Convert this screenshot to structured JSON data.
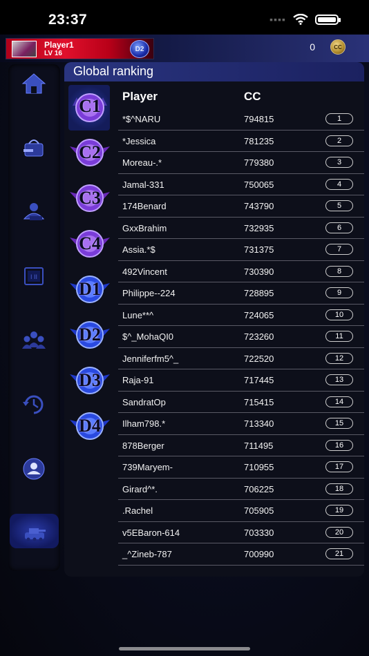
{
  "status": {
    "time": "23:37"
  },
  "player": {
    "name": "Player1",
    "level": "LV 16",
    "badge": "D2"
  },
  "currency": {
    "amount": "0",
    "icon_label": "CC"
  },
  "panel": {
    "title": "Global ranking"
  },
  "table": {
    "headers": {
      "player": "Player",
      "cc": "CC"
    },
    "rows": [
      {
        "name": "*$^NARU",
        "cc": "794815",
        "rank": "1"
      },
      {
        "name": "*Jessica",
        "cc": "781235",
        "rank": "2"
      },
      {
        "name": "Moreau-.*",
        "cc": "779380",
        "rank": "3"
      },
      {
        "name": "Jamal-331",
        "cc": "750065",
        "rank": "4"
      },
      {
        "name": "174Benard",
        "cc": "743790",
        "rank": "5"
      },
      {
        "name": "GxxBrahim",
        "cc": "732935",
        "rank": "6"
      },
      {
        "name": "Assia.*$",
        "cc": "731375",
        "rank": "7"
      },
      {
        "name": "492Vincent",
        "cc": "730390",
        "rank": "8"
      },
      {
        "name": "Philippe--224",
        "cc": "728895",
        "rank": "9"
      },
      {
        "name": "Lune**^",
        "cc": "724065",
        "rank": "10"
      },
      {
        "name": "$^_MohaQI0",
        "cc": "723260",
        "rank": "11"
      },
      {
        "name": "Jenniferfm5^_",
        "cc": "722520",
        "rank": "12"
      },
      {
        "name": "Raja-91",
        "cc": "717445",
        "rank": "13"
      },
      {
        "name": "SandratOp",
        "cc": "715415",
        "rank": "14"
      },
      {
        "name": "Ilham798.*",
        "cc": "713340",
        "rank": "15"
      },
      {
        "name": "878Berger",
        "cc": "711495",
        "rank": "16"
      },
      {
        "name": "739Maryem-",
        "cc": "710955",
        "rank": "17"
      },
      {
        "name": "Girard^*.",
        "cc": "706225",
        "rank": "18"
      },
      {
        "name": ".Rachel",
        "cc": "705905",
        "rank": "19"
      },
      {
        "name": "v5EBaron-614",
        "cc": "703330",
        "rank": "20"
      },
      {
        "name": "_^Zineb-787",
        "cc": "700990",
        "rank": "21"
      }
    ]
  },
  "leagues": [
    "C1",
    "C2",
    "C3",
    "C4",
    "D1",
    "D2",
    "D3",
    "D4"
  ],
  "sidebar": [
    "home-icon",
    "shop-icon",
    "profile-vehicle-icon",
    "cards-icon",
    "team-icon",
    "history-icon",
    "account-icon",
    "tanks-icon"
  ],
  "colors": {
    "header_red": "#e0102c",
    "panel_blue": "#2a3580",
    "background": "#0a0d1e"
  }
}
